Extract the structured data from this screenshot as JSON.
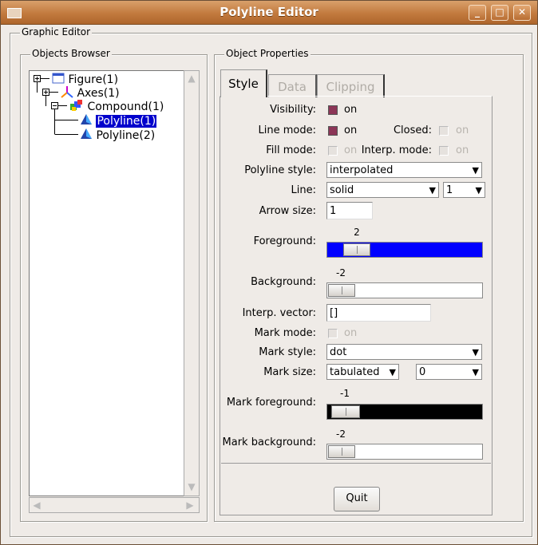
{
  "window": {
    "title": "Polyline Editor"
  },
  "graphic_editor": {
    "legend": "Graphic Editor"
  },
  "objects_browser": {
    "legend": "Objects Browser",
    "tree": [
      {
        "label": "Figure(1)",
        "icon": "figure-icon"
      },
      {
        "label": "Axes(1)",
        "icon": "axes-icon"
      },
      {
        "label": "Compound(1)",
        "icon": "compound-icon"
      },
      {
        "label": "Polyline(1)",
        "icon": "polyline-icon",
        "selected": true
      },
      {
        "label": "Polyline(2)",
        "icon": "polyline-icon"
      }
    ]
  },
  "properties": {
    "legend": "Object Properties",
    "tabs": [
      "Style",
      "Data",
      "Clipping"
    ],
    "active_tab": "Style",
    "visibility": {
      "label": "Visibility:",
      "state": "on",
      "checked": true
    },
    "line_mode": {
      "label": "Line mode:",
      "state": "on",
      "checked": true
    },
    "closed": {
      "label": "Closed:",
      "state": "on",
      "checked": false
    },
    "fill_mode": {
      "label": "Fill mode:",
      "state": "on",
      "checked": false
    },
    "interp_mode": {
      "label": "Interp. mode:",
      "state": "on",
      "checked": false
    },
    "polyline_style": {
      "label": "Polyline style:",
      "value": "interpolated"
    },
    "line": {
      "label": "Line:",
      "style": "solid",
      "width": "1"
    },
    "arrow_size": {
      "label": "Arrow size:",
      "value": "1"
    },
    "foreground": {
      "label": "Foreground:",
      "value": "2",
      "color": "#0000ff"
    },
    "background": {
      "label": "Background:",
      "value": "-2",
      "color": "#ffffff"
    },
    "interp_vector": {
      "label": "Interp. vector:",
      "value": "[]"
    },
    "mark_mode": {
      "label": "Mark mode:",
      "state": "on",
      "checked": false
    },
    "mark_style": {
      "label": "Mark style:",
      "value": "dot"
    },
    "mark_size": {
      "label": "Mark size:",
      "unit": "tabulated",
      "value": "0"
    },
    "mark_foreground": {
      "label": "Mark foreground:",
      "value": "-1",
      "color": "#000000"
    },
    "mark_background": {
      "label": "Mark background:",
      "value": "-2",
      "color": "#ffffff"
    },
    "quit_label": "Quit"
  },
  "colors": {
    "titlebar": "#c27a3e",
    "selection": "#0000cc",
    "checkbox_on": "#8c3657"
  }
}
